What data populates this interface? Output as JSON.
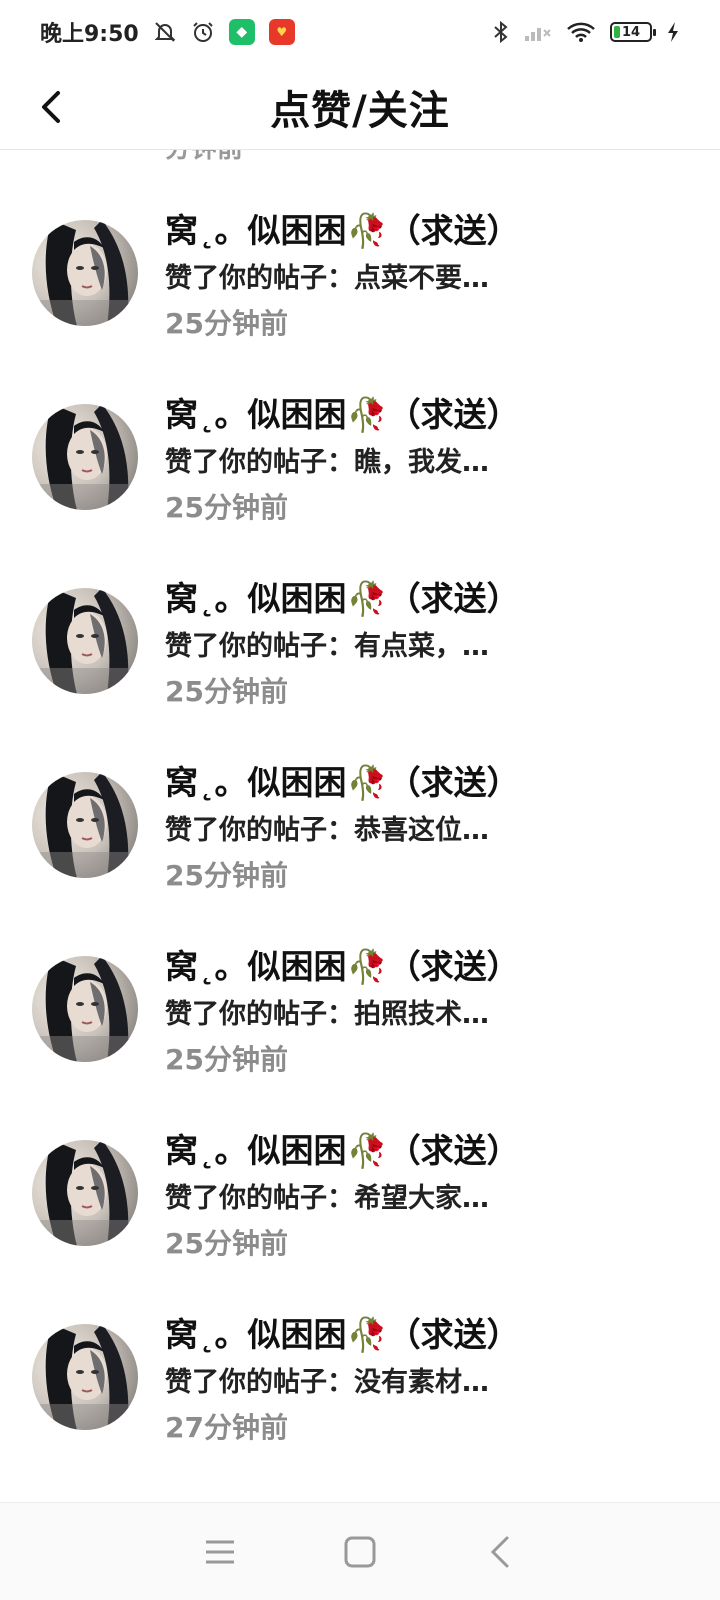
{
  "status_bar": {
    "time": "晚上9:50",
    "battery_level": "14",
    "icons": [
      "bell-muted-icon",
      "alarm-icon",
      "green-app-icon",
      "red-app-icon",
      "bluetooth-icon",
      "signal-icon",
      "wifi-icon",
      "battery-icon",
      "charging-icon"
    ]
  },
  "header": {
    "title": "点赞/关注",
    "back_icon": "chevron-left-icon"
  },
  "partial_row_time": "分钟前",
  "items": [
    {
      "name": "窝˛。似困困🥀（求送）",
      "action": "赞了你的帖子：点菜不要…",
      "time": "25分钟前"
    },
    {
      "name": "窝˛。似困困🥀（求送）",
      "action": "赞了你的帖子：瞧，我发…",
      "time": "25分钟前"
    },
    {
      "name": "窝˛。似困困🥀（求送）",
      "action": "赞了你的帖子：有点菜，…",
      "time": "25分钟前"
    },
    {
      "name": "窝˛。似困困🥀（求送）",
      "action": "赞了你的帖子：恭喜这位…",
      "time": "25分钟前"
    },
    {
      "name": "窝˛。似困困🥀（求送）",
      "action": "赞了你的帖子：拍照技术…",
      "time": "25分钟前"
    },
    {
      "name": "窝˛。似困困🥀（求送）",
      "action": "赞了你的帖子：希望大家…",
      "time": "25分钟前"
    },
    {
      "name": "窝˛。似困困🥀（求送）",
      "action": "赞了你的帖子：没有素材…",
      "time": "27分钟前"
    }
  ],
  "nav_bar": {
    "icons": [
      "menu-icon",
      "home-square-icon",
      "back-triangle-icon"
    ]
  },
  "colors": {
    "text_primary": "#111111",
    "text_secondary": "#8c8c8c",
    "divider": "#e6e6e6"
  }
}
